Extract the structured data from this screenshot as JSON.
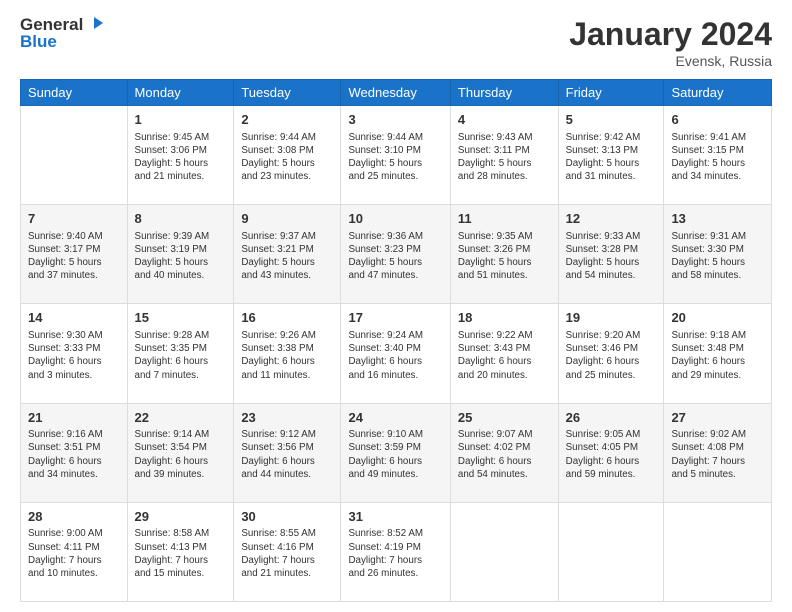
{
  "logo": {
    "line1": "General",
    "line2": "Blue"
  },
  "header": {
    "month": "January 2024",
    "location": "Evensk, Russia"
  },
  "weekdays": [
    "Sunday",
    "Monday",
    "Tuesday",
    "Wednesday",
    "Thursday",
    "Friday",
    "Saturday"
  ],
  "weeks": [
    [
      {
        "day": "",
        "info": ""
      },
      {
        "day": "1",
        "info": "Sunrise: 9:45 AM\nSunset: 3:06 PM\nDaylight: 5 hours\nand 21 minutes."
      },
      {
        "day": "2",
        "info": "Sunrise: 9:44 AM\nSunset: 3:08 PM\nDaylight: 5 hours\nand 23 minutes."
      },
      {
        "day": "3",
        "info": "Sunrise: 9:44 AM\nSunset: 3:10 PM\nDaylight: 5 hours\nand 25 minutes."
      },
      {
        "day": "4",
        "info": "Sunrise: 9:43 AM\nSunset: 3:11 PM\nDaylight: 5 hours\nand 28 minutes."
      },
      {
        "day": "5",
        "info": "Sunrise: 9:42 AM\nSunset: 3:13 PM\nDaylight: 5 hours\nand 31 minutes."
      },
      {
        "day": "6",
        "info": "Sunrise: 9:41 AM\nSunset: 3:15 PM\nDaylight: 5 hours\nand 34 minutes."
      }
    ],
    [
      {
        "day": "7",
        "info": "Sunrise: 9:40 AM\nSunset: 3:17 PM\nDaylight: 5 hours\nand 37 minutes."
      },
      {
        "day": "8",
        "info": "Sunrise: 9:39 AM\nSunset: 3:19 PM\nDaylight: 5 hours\nand 40 minutes."
      },
      {
        "day": "9",
        "info": "Sunrise: 9:37 AM\nSunset: 3:21 PM\nDaylight: 5 hours\nand 43 minutes."
      },
      {
        "day": "10",
        "info": "Sunrise: 9:36 AM\nSunset: 3:23 PM\nDaylight: 5 hours\nand 47 minutes."
      },
      {
        "day": "11",
        "info": "Sunrise: 9:35 AM\nSunset: 3:26 PM\nDaylight: 5 hours\nand 51 minutes."
      },
      {
        "day": "12",
        "info": "Sunrise: 9:33 AM\nSunset: 3:28 PM\nDaylight: 5 hours\nand 54 minutes."
      },
      {
        "day": "13",
        "info": "Sunrise: 9:31 AM\nSunset: 3:30 PM\nDaylight: 5 hours\nand 58 minutes."
      }
    ],
    [
      {
        "day": "14",
        "info": "Sunrise: 9:30 AM\nSunset: 3:33 PM\nDaylight: 6 hours\nand 3 minutes."
      },
      {
        "day": "15",
        "info": "Sunrise: 9:28 AM\nSunset: 3:35 PM\nDaylight: 6 hours\nand 7 minutes."
      },
      {
        "day": "16",
        "info": "Sunrise: 9:26 AM\nSunset: 3:38 PM\nDaylight: 6 hours\nand 11 minutes."
      },
      {
        "day": "17",
        "info": "Sunrise: 9:24 AM\nSunset: 3:40 PM\nDaylight: 6 hours\nand 16 minutes."
      },
      {
        "day": "18",
        "info": "Sunrise: 9:22 AM\nSunset: 3:43 PM\nDaylight: 6 hours\nand 20 minutes."
      },
      {
        "day": "19",
        "info": "Sunrise: 9:20 AM\nSunset: 3:46 PM\nDaylight: 6 hours\nand 25 minutes."
      },
      {
        "day": "20",
        "info": "Sunrise: 9:18 AM\nSunset: 3:48 PM\nDaylight: 6 hours\nand 29 minutes."
      }
    ],
    [
      {
        "day": "21",
        "info": "Sunrise: 9:16 AM\nSunset: 3:51 PM\nDaylight: 6 hours\nand 34 minutes."
      },
      {
        "day": "22",
        "info": "Sunrise: 9:14 AM\nSunset: 3:54 PM\nDaylight: 6 hours\nand 39 minutes."
      },
      {
        "day": "23",
        "info": "Sunrise: 9:12 AM\nSunset: 3:56 PM\nDaylight: 6 hours\nand 44 minutes."
      },
      {
        "day": "24",
        "info": "Sunrise: 9:10 AM\nSunset: 3:59 PM\nDaylight: 6 hours\nand 49 minutes."
      },
      {
        "day": "25",
        "info": "Sunrise: 9:07 AM\nSunset: 4:02 PM\nDaylight: 6 hours\nand 54 minutes."
      },
      {
        "day": "26",
        "info": "Sunrise: 9:05 AM\nSunset: 4:05 PM\nDaylight: 6 hours\nand 59 minutes."
      },
      {
        "day": "27",
        "info": "Sunrise: 9:02 AM\nSunset: 4:08 PM\nDaylight: 7 hours\nand 5 minutes."
      }
    ],
    [
      {
        "day": "28",
        "info": "Sunrise: 9:00 AM\nSunset: 4:11 PM\nDaylight: 7 hours\nand 10 minutes."
      },
      {
        "day": "29",
        "info": "Sunrise: 8:58 AM\nSunset: 4:13 PM\nDaylight: 7 hours\nand 15 minutes."
      },
      {
        "day": "30",
        "info": "Sunrise: 8:55 AM\nSunset: 4:16 PM\nDaylight: 7 hours\nand 21 minutes."
      },
      {
        "day": "31",
        "info": "Sunrise: 8:52 AM\nSunset: 4:19 PM\nDaylight: 7 hours\nand 26 minutes."
      },
      {
        "day": "",
        "info": ""
      },
      {
        "day": "",
        "info": ""
      },
      {
        "day": "",
        "info": ""
      }
    ]
  ]
}
